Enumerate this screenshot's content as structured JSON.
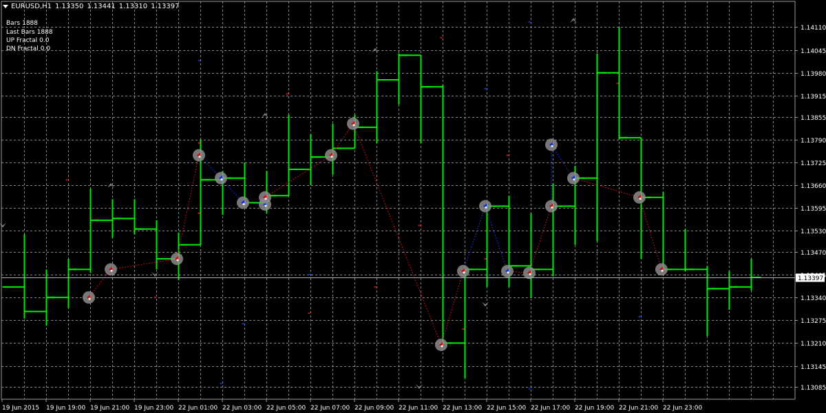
{
  "header": {
    "symbol": "EURUSD,H1",
    "ohlc": [
      "1.13350",
      "1.13441",
      "1.13310",
      "1.13397"
    ]
  },
  "stats": [
    {
      "label": "Bars",
      "value": "1888"
    },
    {
      "label": "Last Bars",
      "value": "1888"
    },
    {
      "label": "UP Fractal",
      "value": "0.0"
    },
    {
      "label": "DN Fractal",
      "value": "0.0"
    }
  ],
  "colors": {
    "background": "#000000",
    "grid": "#8a8a8a",
    "bars": "#00ee00",
    "up_line": "#cc1111",
    "down_line": "#1133dd",
    "marker": "#8c8c8c",
    "fractal_arrow": "#888888",
    "axis_text": "#ffffff",
    "price_line": "#a8b4c2"
  },
  "chart_data": {
    "type": "ohlc",
    "symbol": "EURUSD",
    "timeframe": "H1",
    "ylim": [
      1.1305,
      1.1416
    ],
    "y_ticks": [
      "1.14110",
      "1.14045",
      "1.13980",
      "1.13915",
      "1.13855",
      "1.13790",
      "1.13725",
      "1.13660",
      "1.13595",
      "1.13530",
      "1.13470",
      "1.13405",
      "1.13340",
      "1.13275",
      "1.13210",
      "1.13145",
      "1.13085"
    ],
    "x_labels": [
      "19 Jun 2015",
      "19 Jun 19:00",
      "19 Jun 21:00",
      "19 Jun 23:00",
      "22 Jun 01:00",
      "22 Jun 03:00",
      "22 Jun 05:00",
      "22 Jun 07:00",
      "22 Jun 09:00",
      "22 Jun 11:00",
      "22 Jun 13:00",
      "22 Jun 15:00",
      "22 Jun 17:00",
      "22 Jun 19:00",
      "22 Jun 21:00",
      "22 Jun 23:00"
    ],
    "current_price": "1.13397",
    "bars": [
      {
        "o": 1.1337,
        "h": 1.1352,
        "l": 1.1328,
        "c": 1.133
      },
      {
        "o": 1.133,
        "h": 1.1342,
        "l": 1.1326,
        "c": 1.1334
      },
      {
        "o": 1.1334,
        "h": 1.1345,
        "l": 1.1331,
        "c": 1.1342
      },
      {
        "o": 1.1342,
        "h": 1.1365,
        "l": 1.1341,
        "c": 1.1356
      },
      {
        "o": 1.1356,
        "h": 1.1362,
        "l": 1.1351,
        "c": 1.13565
      },
      {
        "o": 1.13565,
        "h": 1.1362,
        "l": 1.1352,
        "c": 1.13535
      },
      {
        "o": 1.13535,
        "h": 1.1356,
        "l": 1.1342,
        "c": 1.1345
      },
      {
        "o": 1.1345,
        "h": 1.13525,
        "l": 1.1339,
        "c": 1.1349
      },
      {
        "o": 1.1349,
        "h": 1.1379,
        "l": 1.1363,
        "c": 1.13675
      },
      {
        "o": 1.13675,
        "h": 1.137,
        "l": 1.13575,
        "c": 1.1368
      },
      {
        "o": 1.1368,
        "h": 1.13725,
        "l": 1.136,
        "c": 1.1361
      },
      {
        "o": 1.1361,
        "h": 1.137,
        "l": 1.1358,
        "c": 1.1363
      },
      {
        "o": 1.1363,
        "h": 1.1386,
        "l": 1.1366,
        "c": 1.13705
      },
      {
        "o": 1.13705,
        "h": 1.13805,
        "l": 1.1366,
        "c": 1.1374
      },
      {
        "o": 1.1374,
        "h": 1.13835,
        "l": 1.1369,
        "c": 1.13765
      },
      {
        "o": 1.13765,
        "h": 1.1386,
        "l": 1.13765,
        "c": 1.13825
      },
      {
        "o": 1.13825,
        "h": 1.13985,
        "l": 1.1378,
        "c": 1.1396
      },
      {
        "o": 1.1396,
        "h": 1.14035,
        "l": 1.1389,
        "c": 1.1403
      },
      {
        "o": 1.1403,
        "h": 1.1402,
        "l": 1.1378,
        "c": 1.1394
      },
      {
        "o": 1.1394,
        "h": 1.13945,
        "l": 1.1321,
        "c": 1.1321
      },
      {
        "o": 1.1321,
        "h": 1.1342,
        "l": 1.1311,
        "c": 1.1342
      },
      {
        "o": 1.1342,
        "h": 1.1361,
        "l": 1.1337,
        "c": 1.136
      },
      {
        "o": 1.136,
        "h": 1.1363,
        "l": 1.1337,
        "c": 1.1343
      },
      {
        "o": 1.1343,
        "h": 1.1358,
        "l": 1.1334,
        "c": 1.1342
      },
      {
        "o": 1.1342,
        "h": 1.13665,
        "l": 1.134,
        "c": 1.136
      },
      {
        "o": 1.136,
        "h": 1.13715,
        "l": 1.1349,
        "c": 1.1368
      },
      {
        "o": 1.1368,
        "h": 1.14035,
        "l": 1.135,
        "c": 1.1398
      },
      {
        "o": 1.1398,
        "h": 1.1411,
        "l": 1.1379,
        "c": 1.13795
      },
      {
        "o": 1.13795,
        "h": 1.1379,
        "l": 1.1345,
        "c": 1.13625
      },
      {
        "o": 1.13625,
        "h": 1.1364,
        "l": 1.1342,
        "c": 1.1342
      },
      {
        "o": 1.1342,
        "h": 1.13535,
        "l": 1.13415,
        "c": 1.1342
      },
      {
        "o": 1.1342,
        "h": 1.1343,
        "l": 1.1323,
        "c": 1.13365
      },
      {
        "o": 1.13365,
        "h": 1.13415,
        "l": 1.13305,
        "c": 1.1337
      },
      {
        "o": 1.1337,
        "h": 1.1345,
        "l": 1.1336,
        "c": 1.13397
      }
    ],
    "zigzag": [
      {
        "bar": 2,
        "price": 1.1334,
        "dir": "up"
      },
      {
        "bar": 3,
        "price": 1.1342,
        "dir": "up"
      },
      {
        "bar": 6,
        "price": 1.1345,
        "dir": "up"
      },
      {
        "bar": 7,
        "price": 1.13745,
        "dir": "up"
      },
      {
        "bar": 8,
        "price": 1.1368,
        "dir": "down"
      },
      {
        "bar": 9,
        "price": 1.1361,
        "dir": "down"
      },
      {
        "bar": 10,
        "price": 1.13605,
        "dir": "down"
      },
      {
        "bar": 10,
        "price": 1.13625,
        "dir": "up"
      },
      {
        "bar": 13,
        "price": 1.13745,
        "dir": "up"
      },
      {
        "bar": 14,
        "price": 1.13835,
        "dir": "up"
      },
      {
        "bar": 18,
        "price": 1.13205,
        "dir": "up"
      },
      {
        "bar": 19,
        "price": 1.13415,
        "dir": "up"
      },
      {
        "bar": 20,
        "price": 1.136,
        "dir": "down"
      },
      {
        "bar": 21,
        "price": 1.13415,
        "dir": "down"
      },
      {
        "bar": 22,
        "price": 1.1341,
        "dir": "up"
      },
      {
        "bar": 23,
        "price": 1.136,
        "dir": "up"
      },
      {
        "bar": 23,
        "price": 1.13775,
        "dir": "down"
      },
      {
        "bar": 24,
        "price": 1.1368,
        "dir": "down"
      },
      {
        "bar": 27,
        "price": 1.13625,
        "dir": "up"
      },
      {
        "bar": 28,
        "price": 1.1342,
        "dir": "up"
      }
    ],
    "fractals": [
      {
        "bar": 3,
        "type": "up",
        "price": 1.1366
      },
      {
        "bar": 5,
        "type": "down",
        "price": 1.13405
      },
      {
        "bar": 10,
        "type": "up",
        "price": 1.1386
      },
      {
        "bar": 15,
        "type": "up",
        "price": 1.14045
      },
      {
        "bar": 17,
        "type": "down",
        "price": 1.13085
      },
      {
        "bar": 20,
        "type": "down",
        "price": 1.1332
      },
      {
        "bar": 24,
        "type": "up",
        "price": 1.1413
      },
      {
        "bar": -1,
        "type": "down",
        "price": 1.13545
      }
    ],
    "dots": [
      {
        "bar": 1,
        "price": 1.13675,
        "color": "red"
      },
      {
        "bar": 5,
        "price": 1.1334,
        "color": "red"
      },
      {
        "bar": 7,
        "price": 1.1378,
        "color": "red"
      },
      {
        "bar": 7,
        "price": 1.1358,
        "color": "red"
      },
      {
        "bar": 11,
        "price": 1.1392,
        "color": "red"
      },
      {
        "bar": 12,
        "price": 1.13295,
        "color": "red"
      },
      {
        "bar": 15,
        "price": 1.1337,
        "color": "red"
      },
      {
        "bar": 17,
        "price": 1.13545,
        "color": "red"
      },
      {
        "bar": 18,
        "price": 1.1408,
        "color": "red"
      },
      {
        "bar": 19,
        "price": 1.1325,
        "color": "red"
      },
      {
        "bar": 20,
        "price": 1.1345,
        "color": "red"
      },
      {
        "bar": 21,
        "price": 1.13745,
        "color": "red"
      },
      {
        "bar": 26,
        "price": 1.1395,
        "color": "red"
      },
      {
        "bar": 7,
        "price": 1.14015,
        "color": "blue"
      },
      {
        "bar": 8,
        "price": 1.13095,
        "color": "blue"
      },
      {
        "bar": 9,
        "price": 1.13265,
        "color": "blue"
      },
      {
        "bar": 12,
        "price": 1.13405,
        "color": "blue"
      },
      {
        "bar": 20,
        "price": 1.13935,
        "color": "blue"
      },
      {
        "bar": 22,
        "price": 1.14125,
        "color": "blue"
      },
      {
        "bar": 22,
        "price": 1.1308,
        "color": "blue"
      },
      {
        "bar": 27,
        "price": 1.13285,
        "color": "blue"
      }
    ]
  }
}
